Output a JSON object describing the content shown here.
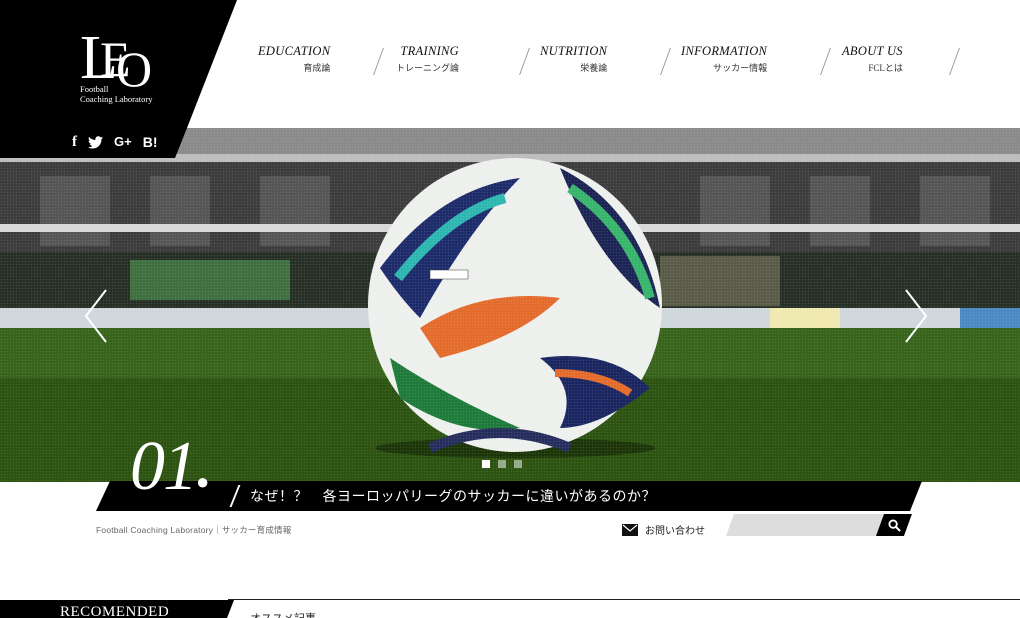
{
  "logo": {
    "line1": "Football",
    "line2": "Coaching Laboratory"
  },
  "social": {
    "facebook": "f",
    "google_plus": "G+",
    "hatena": "B!"
  },
  "nav": [
    {
      "en": "EDUCATION",
      "jp": "育成論"
    },
    {
      "en": "TRAINING",
      "jp": "トレーニング論"
    },
    {
      "en": "NUTRITION",
      "jp": "栄養論"
    },
    {
      "en": "INFORMATION",
      "jp": "サッカー情報"
    },
    {
      "en": "ABOUT US",
      "jp": "FCLとは"
    }
  ],
  "slider": {
    "number": "01",
    "caption": "なぜ！？　各ヨーロッパリーグのサッカーに違いがあるのか？",
    "slide_count": 3,
    "active_slide": 1
  },
  "breadcrumb": "Football Coaching Laboratory｜サッカー育成情報",
  "contact_label": "お問い合わせ",
  "search": {
    "placeholder": ""
  },
  "recommended": {
    "label": "RECOMENDED",
    "jp": "オススメ記事"
  },
  "colors": {
    "primary": "#000000",
    "accent": "#ffffff",
    "search_bg": "#dddddd"
  }
}
